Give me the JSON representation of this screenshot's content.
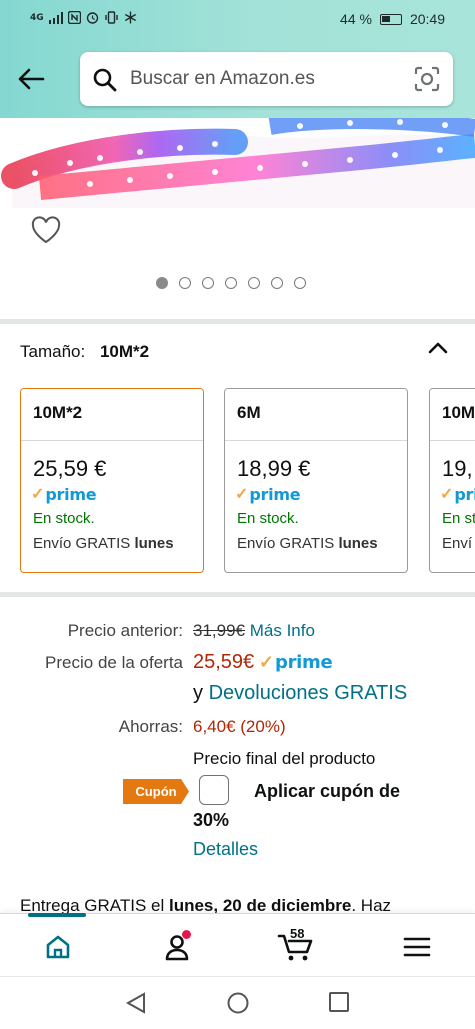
{
  "status_bar": {
    "network": "4G",
    "battery": "44 %",
    "time": "20:49"
  },
  "search": {
    "placeholder": "Buscar en Amazon.es"
  },
  "carousel": {
    "dot_count": 7,
    "active_index": 0
  },
  "size_selector": {
    "label": "Tamaño:",
    "selected": "10M*2",
    "options": [
      {
        "name": "10M*2",
        "price": "25,59 €",
        "prime": "prime",
        "stock": "En stock.",
        "shipping": "Envío GRATIS",
        "shipping_day": "lunes"
      },
      {
        "name": "6M",
        "price": "18,99 €",
        "prime": "prime",
        "stock": "En stock.",
        "shipping": "Envío GRATIS",
        "shipping_day": "lunes"
      },
      {
        "name": "10M",
        "price": "19,",
        "prime": "pri",
        "stock": "En st",
        "shipping": "Enví",
        "shipping_day": ""
      }
    ]
  },
  "pricing": {
    "previous_label": "Precio anterior:",
    "previous_price": "31,99€",
    "more_info": "Más Info",
    "deal_label": "Precio de la oferta",
    "deal_price": "25,59€",
    "prime": "prime",
    "returns_prefix": "y",
    "returns_link": "Devoluciones GRATIS",
    "savings_label": "Ahorras:",
    "savings_value": "6,40€ (20%)",
    "final_price_note": "Precio final del producto"
  },
  "coupon": {
    "tag": "Cupón",
    "text_line1": "Aplicar cupón de",
    "text_line2": "30%",
    "details_link": "Detalles"
  },
  "delivery": {
    "prefix": "Entrega GRATIS el",
    "date": "lunes, 20 de diciembre",
    "suffix": ". Haz"
  },
  "bottom_nav": {
    "cart_count": "58"
  },
  "colors": {
    "accent_teal": "#007185",
    "prime_blue": "#1399d6",
    "deal_red": "#b12704",
    "stock_green": "#007600",
    "coupon_orange": "#e47911"
  }
}
